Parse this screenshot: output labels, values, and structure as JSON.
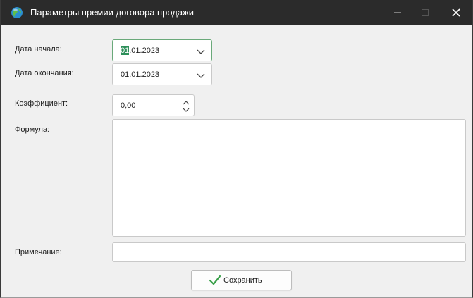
{
  "window": {
    "title": "Параметры премии договора продажи",
    "title_icon": "app-globe-icon",
    "controls": {
      "minimize_icon": "minimize-icon",
      "maximize_icon": "maximize-icon",
      "close_icon": "close-icon"
    }
  },
  "form": {
    "start_date": {
      "label": "Дата начала:",
      "value_selected": "01",
      "value_rest": ".01.2023",
      "icon": "chevron-down-icon"
    },
    "end_date": {
      "label": "Дата окончания:",
      "value": "01.01.2023",
      "icon": "chevron-down-icon"
    },
    "coefficient": {
      "label": "Коэффициент:",
      "value": "0,00",
      "icon": "spinner-icon"
    },
    "formula": {
      "label": "Формула:",
      "value": ""
    },
    "note": {
      "label": "Примечание:",
      "value": ""
    }
  },
  "actions": {
    "save_label": "Сохранить",
    "save_icon": "checkmark-icon"
  },
  "colors": {
    "titlebar": "#2b2b2b",
    "window_bg": "#f0f0f0",
    "focus_border": "#6aa97a",
    "selection": "#2e8f5a",
    "checkmark": "#3aa04a"
  }
}
